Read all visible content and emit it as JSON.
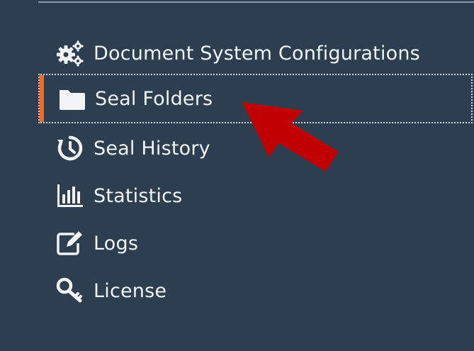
{
  "menu": {
    "items": [
      {
        "label": "Document System Configurations",
        "icon": "gears-icon"
      },
      {
        "label": "Seal Folders",
        "icon": "folder-icon",
        "active": true
      },
      {
        "label": "Seal History",
        "icon": "history-icon"
      },
      {
        "label": "Statistics",
        "icon": "bar-chart-icon"
      },
      {
        "label": "Logs",
        "icon": "edit-icon"
      },
      {
        "label": "License",
        "icon": "key-icon"
      }
    ]
  },
  "colors": {
    "background": "#2c3e50",
    "accent": "#f26b21",
    "arrow": "#c00000",
    "text": "#f2f4f6"
  }
}
